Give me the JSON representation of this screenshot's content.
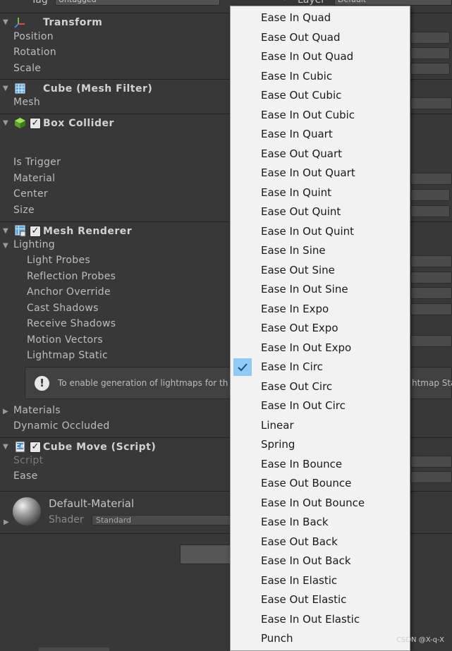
{
  "top_row": {
    "tag_label": "Tag",
    "tag_value": "Untagged",
    "layer_label": "Layer",
    "layer_value": "Default"
  },
  "transform": {
    "title": "Transform",
    "props": [
      "Position",
      "Rotation",
      "Scale"
    ]
  },
  "mesh_filter": {
    "title": "Cube (Mesh Filter)",
    "props": [
      "Mesh"
    ]
  },
  "box_collider": {
    "title": "Box Collider",
    "props": [
      "Is Trigger",
      "Material",
      "Center",
      "Size"
    ]
  },
  "mesh_renderer": {
    "title": "Mesh Renderer",
    "section": "Lighting",
    "props": [
      "Light Probes",
      "Reflection Probes",
      "Anchor Override",
      "Cast Shadows",
      "Receive Shadows",
      "Motion Vectors",
      "Lightmap Static"
    ],
    "info_message": "To enable generation of lightmaps for th",
    "info_message_tail": "htmap Sta",
    "materials_label": "Materials",
    "dynamic_occluded_label": "Dynamic Occluded"
  },
  "script_component": {
    "title": "Cube Move (Script)",
    "script_label": "Script",
    "ease_label": "Ease"
  },
  "material": {
    "name": "Default-Material",
    "shader_label": "Shader",
    "shader_value": "Standard"
  },
  "dropdown": {
    "selected_index": 18,
    "checkmark": "✔",
    "items": [
      "Ease In Quad",
      "Ease Out Quad",
      "Ease In Out Quad",
      "Ease In Cubic",
      "Ease Out Cubic",
      "Ease In Out Cubic",
      "Ease In Quart",
      "Ease Out Quart",
      "Ease In Out Quart",
      "Ease In Quint",
      "Ease Out Quint",
      "Ease In Out Quint",
      "Ease In Sine",
      "Ease Out Sine",
      "Ease In Out Sine",
      "Ease In Expo",
      "Ease Out Expo",
      "Ease In Out Expo",
      "Ease In Circ",
      "Ease Out Circ",
      "Ease In Out Circ",
      "Linear",
      "Spring",
      "Ease In Bounce",
      "Ease Out Bounce",
      "Ease In Out Bounce",
      "Ease In Back",
      "Ease Out Back",
      "Ease In Out Back",
      "Ease In Elastic",
      "Ease Out Elastic",
      "Ease In Out Elastic",
      "Punch"
    ]
  },
  "watermark": "CSDN @X-q-X",
  "colors": {
    "panel_bg": "#383838",
    "menu_bg": "#f2f2f2",
    "selection": "#91c9f7"
  }
}
